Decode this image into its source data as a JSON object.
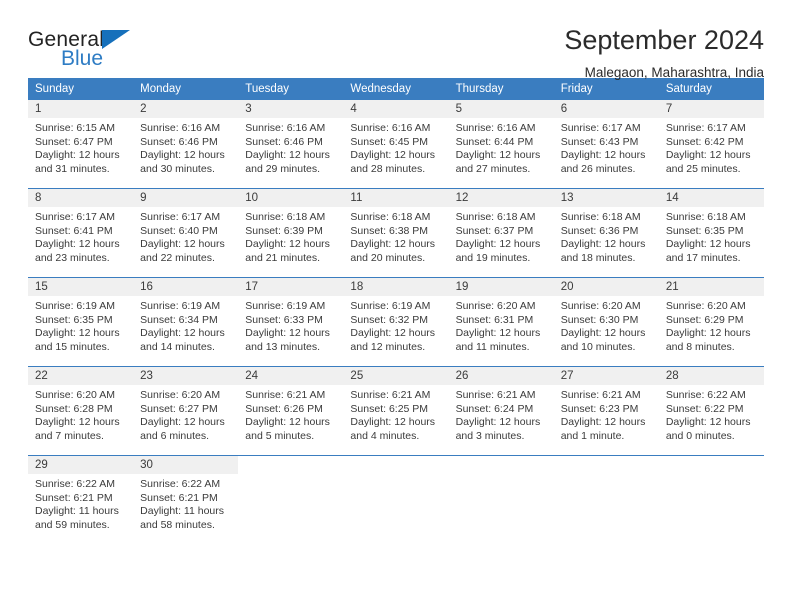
{
  "brand": {
    "name_top": "General",
    "name_bottom": "Blue",
    "triangle_color": "#1670bb",
    "blue_text_color": "#2e7cc4",
    "logo_icon": "triangle-flag-icon"
  },
  "header": {
    "title": "September 2024",
    "subtitle": "Malegaon, Maharashtra, India"
  },
  "theme": {
    "header_blue": "#3a7dc0",
    "daynum_background": "#f0f0f0",
    "text_color": "#3b3b3b"
  },
  "calendar": {
    "weekday_headers": [
      "Sunday",
      "Monday",
      "Tuesday",
      "Wednesday",
      "Thursday",
      "Friday",
      "Saturday"
    ],
    "weeks": [
      [
        {
          "day": "1",
          "sunrise": "Sunrise: 6:15 AM",
          "sunset": "Sunset: 6:47 PM",
          "daylight": "Daylight: 12 hours and 31 minutes."
        },
        {
          "day": "2",
          "sunrise": "Sunrise: 6:16 AM",
          "sunset": "Sunset: 6:46 PM",
          "daylight": "Daylight: 12 hours and 30 minutes."
        },
        {
          "day": "3",
          "sunrise": "Sunrise: 6:16 AM",
          "sunset": "Sunset: 6:46 PM",
          "daylight": "Daylight: 12 hours and 29 minutes."
        },
        {
          "day": "4",
          "sunrise": "Sunrise: 6:16 AM",
          "sunset": "Sunset: 6:45 PM",
          "daylight": "Daylight: 12 hours and 28 minutes."
        },
        {
          "day": "5",
          "sunrise": "Sunrise: 6:16 AM",
          "sunset": "Sunset: 6:44 PM",
          "daylight": "Daylight: 12 hours and 27 minutes."
        },
        {
          "day": "6",
          "sunrise": "Sunrise: 6:17 AM",
          "sunset": "Sunset: 6:43 PM",
          "daylight": "Daylight: 12 hours and 26 minutes."
        },
        {
          "day": "7",
          "sunrise": "Sunrise: 6:17 AM",
          "sunset": "Sunset: 6:42 PM",
          "daylight": "Daylight: 12 hours and 25 minutes."
        }
      ],
      [
        {
          "day": "8",
          "sunrise": "Sunrise: 6:17 AM",
          "sunset": "Sunset: 6:41 PM",
          "daylight": "Daylight: 12 hours and 23 minutes."
        },
        {
          "day": "9",
          "sunrise": "Sunrise: 6:17 AM",
          "sunset": "Sunset: 6:40 PM",
          "daylight": "Daylight: 12 hours and 22 minutes."
        },
        {
          "day": "10",
          "sunrise": "Sunrise: 6:18 AM",
          "sunset": "Sunset: 6:39 PM",
          "daylight": "Daylight: 12 hours and 21 minutes."
        },
        {
          "day": "11",
          "sunrise": "Sunrise: 6:18 AM",
          "sunset": "Sunset: 6:38 PM",
          "daylight": "Daylight: 12 hours and 20 minutes."
        },
        {
          "day": "12",
          "sunrise": "Sunrise: 6:18 AM",
          "sunset": "Sunset: 6:37 PM",
          "daylight": "Daylight: 12 hours and 19 minutes."
        },
        {
          "day": "13",
          "sunrise": "Sunrise: 6:18 AM",
          "sunset": "Sunset: 6:36 PM",
          "daylight": "Daylight: 12 hours and 18 minutes."
        },
        {
          "day": "14",
          "sunrise": "Sunrise: 6:18 AM",
          "sunset": "Sunset: 6:35 PM",
          "daylight": "Daylight: 12 hours and 17 minutes."
        }
      ],
      [
        {
          "day": "15",
          "sunrise": "Sunrise: 6:19 AM",
          "sunset": "Sunset: 6:35 PM",
          "daylight": "Daylight: 12 hours and 15 minutes."
        },
        {
          "day": "16",
          "sunrise": "Sunrise: 6:19 AM",
          "sunset": "Sunset: 6:34 PM",
          "daylight": "Daylight: 12 hours and 14 minutes."
        },
        {
          "day": "17",
          "sunrise": "Sunrise: 6:19 AM",
          "sunset": "Sunset: 6:33 PM",
          "daylight": "Daylight: 12 hours and 13 minutes."
        },
        {
          "day": "18",
          "sunrise": "Sunrise: 6:19 AM",
          "sunset": "Sunset: 6:32 PM",
          "daylight": "Daylight: 12 hours and 12 minutes."
        },
        {
          "day": "19",
          "sunrise": "Sunrise: 6:20 AM",
          "sunset": "Sunset: 6:31 PM",
          "daylight": "Daylight: 12 hours and 11 minutes."
        },
        {
          "day": "20",
          "sunrise": "Sunrise: 6:20 AM",
          "sunset": "Sunset: 6:30 PM",
          "daylight": "Daylight: 12 hours and 10 minutes."
        },
        {
          "day": "21",
          "sunrise": "Sunrise: 6:20 AM",
          "sunset": "Sunset: 6:29 PM",
          "daylight": "Daylight: 12 hours and 8 minutes."
        }
      ],
      [
        {
          "day": "22",
          "sunrise": "Sunrise: 6:20 AM",
          "sunset": "Sunset: 6:28 PM",
          "daylight": "Daylight: 12 hours and 7 minutes."
        },
        {
          "day": "23",
          "sunrise": "Sunrise: 6:20 AM",
          "sunset": "Sunset: 6:27 PM",
          "daylight": "Daylight: 12 hours and 6 minutes."
        },
        {
          "day": "24",
          "sunrise": "Sunrise: 6:21 AM",
          "sunset": "Sunset: 6:26 PM",
          "daylight": "Daylight: 12 hours and 5 minutes."
        },
        {
          "day": "25",
          "sunrise": "Sunrise: 6:21 AM",
          "sunset": "Sunset: 6:25 PM",
          "daylight": "Daylight: 12 hours and 4 minutes."
        },
        {
          "day": "26",
          "sunrise": "Sunrise: 6:21 AM",
          "sunset": "Sunset: 6:24 PM",
          "daylight": "Daylight: 12 hours and 3 minutes."
        },
        {
          "day": "27",
          "sunrise": "Sunrise: 6:21 AM",
          "sunset": "Sunset: 6:23 PM",
          "daylight": "Daylight: 12 hours and 1 minute."
        },
        {
          "day": "28",
          "sunrise": "Sunrise: 6:22 AM",
          "sunset": "Sunset: 6:22 PM",
          "daylight": "Daylight: 12 hours and 0 minutes."
        }
      ],
      [
        {
          "day": "29",
          "sunrise": "Sunrise: 6:22 AM",
          "sunset": "Sunset: 6:21 PM",
          "daylight": "Daylight: 11 hours and 59 minutes."
        },
        {
          "day": "30",
          "sunrise": "Sunrise: 6:22 AM",
          "sunset": "Sunset: 6:21 PM",
          "daylight": "Daylight: 11 hours and 58 minutes."
        },
        {
          "day": "",
          "sunrise": "",
          "sunset": "",
          "daylight": ""
        },
        {
          "day": "",
          "sunrise": "",
          "sunset": "",
          "daylight": ""
        },
        {
          "day": "",
          "sunrise": "",
          "sunset": "",
          "daylight": ""
        },
        {
          "day": "",
          "sunrise": "",
          "sunset": "",
          "daylight": ""
        },
        {
          "day": "",
          "sunrise": "",
          "sunset": "",
          "daylight": ""
        }
      ]
    ]
  }
}
